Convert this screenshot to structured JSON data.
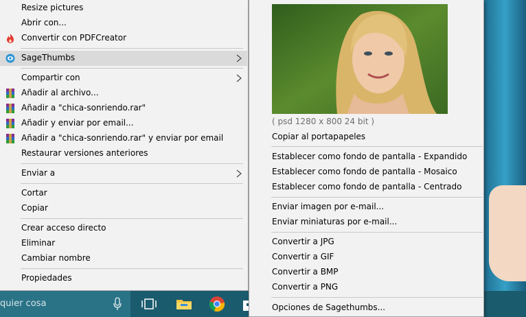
{
  "context_menu": {
    "items": [
      {
        "label": "Resize pictures"
      },
      {
        "label": "Abrir con..."
      },
      {
        "label": "Convertir con PDFCreator",
        "icon": "pdfcreator-icon"
      },
      {
        "label": "SageThumbs",
        "icon": "sagethumbs-icon",
        "submenu": true,
        "highlighted": true
      },
      {
        "label": "Compartir con",
        "submenu": true
      },
      {
        "label": "Añadir al archivo...",
        "icon": "winrar-icon"
      },
      {
        "label": "Añadir a \"chica-sonriendo.rar\"",
        "icon": "winrar-icon"
      },
      {
        "label": "Añadir y enviar por email...",
        "icon": "winrar-icon"
      },
      {
        "label": "Añadir a \"chica-sonriendo.rar\" y enviar por email",
        "icon": "winrar-icon"
      },
      {
        "label": "Restaurar versiones anteriores"
      },
      {
        "label": "Enviar a",
        "submenu": true
      },
      {
        "label": "Cortar"
      },
      {
        "label": "Copiar"
      },
      {
        "label": "Crear acceso directo"
      },
      {
        "label": "Eliminar"
      },
      {
        "label": "Cambiar nombre"
      },
      {
        "label": "Propiedades"
      }
    ]
  },
  "submenu": {
    "image_info": "( psd 1280 x 800 24 bit )",
    "items": [
      {
        "label": "Copiar al portapapeles"
      },
      {
        "label": "Establecer como fondo de pantalla - Expandido"
      },
      {
        "label": "Establecer como fondo de pantalla - Mosaico"
      },
      {
        "label": "Establecer como fondo de pantalla - Centrado"
      },
      {
        "label": "Enviar imagen por e-mail..."
      },
      {
        "label": "Enviar miniaturas por e-mail..."
      },
      {
        "label": "Convertir a JPG"
      },
      {
        "label": "Convertir a GIF"
      },
      {
        "label": "Convertir a BMP"
      },
      {
        "label": "Convertir a PNG"
      },
      {
        "label": "Opciones de Sagethumbs..."
      }
    ]
  },
  "taskbar": {
    "search_text": "quier cosa",
    "icons": [
      "microphone-icon",
      "task-view-icon",
      "file-explorer-icon",
      "chrome-icon",
      "store-icon"
    ]
  },
  "colors": {
    "menu_bg": "#f2f2f2",
    "highlight": "#dadada",
    "taskbar": "#1b5b6e"
  }
}
